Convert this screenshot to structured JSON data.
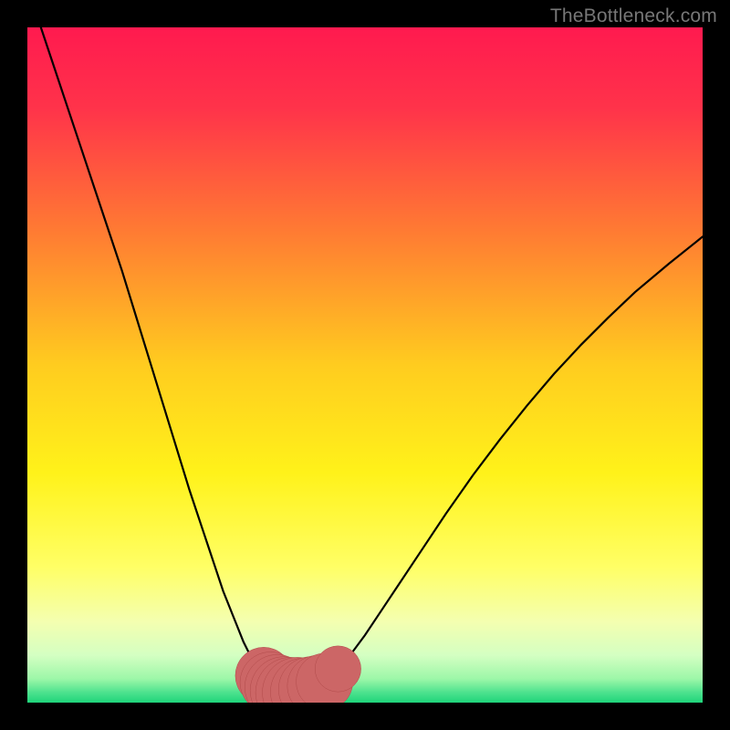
{
  "watermark": "TheBottleneck.com",
  "colors": {
    "frame": "#000000",
    "watermark": "#777777",
    "curve": "#000000",
    "markers_fill": "#cc6666",
    "markers_stroke": "#b24a4a",
    "gradient_stops": [
      {
        "offset": 0,
        "color": "#ff1a4f"
      },
      {
        "offset": 0.12,
        "color": "#ff334a"
      },
      {
        "offset": 0.3,
        "color": "#ff7a33"
      },
      {
        "offset": 0.5,
        "color": "#ffcc1f"
      },
      {
        "offset": 0.66,
        "color": "#fff21a"
      },
      {
        "offset": 0.8,
        "color": "#ffff66"
      },
      {
        "offset": 0.88,
        "color": "#f4ffb0"
      },
      {
        "offset": 0.93,
        "color": "#d4ffc2"
      },
      {
        "offset": 0.965,
        "color": "#9cf7a8"
      },
      {
        "offset": 0.985,
        "color": "#4de28e"
      },
      {
        "offset": 1.0,
        "color": "#1fd47a"
      }
    ]
  },
  "chart_data": {
    "type": "line",
    "title": "",
    "xlabel": "",
    "ylabel": "",
    "xlim": [
      0,
      100
    ],
    "ylim": [
      0,
      100
    ],
    "grid": false,
    "legend": false,
    "series": [
      {
        "name": "bottleneck-curve",
        "x": [
          2,
          4,
          6,
          8,
          10,
          12,
          14,
          16,
          18,
          20,
          22,
          24,
          25,
          26,
          27,
          28,
          29,
          30,
          31,
          32,
          33,
          34,
          35,
          36,
          37,
          38,
          39,
          40,
          41,
          42,
          44,
          46,
          48,
          50,
          52,
          55,
          58,
          62,
          66,
          70,
          74,
          78,
          82,
          86,
          90,
          95,
          100
        ],
        "y": [
          100,
          94,
          88,
          82,
          76,
          70,
          64,
          57.5,
          51,
          44.5,
          38,
          31.5,
          28.5,
          25.5,
          22.5,
          19.5,
          16.5,
          14,
          11.5,
          9,
          7,
          5.3,
          4,
          3,
          2.3,
          1.8,
          1.5,
          1.5,
          1.6,
          2,
          3.1,
          5,
          7.3,
          10,
          13,
          17.5,
          22,
          28,
          33.7,
          39,
          44,
          48.7,
          53,
          57,
          60.8,
          65,
          69
        ]
      }
    ],
    "markers": {
      "name": "highlight-points",
      "x": [
        35,
        36,
        37,
        38,
        39,
        40,
        41,
        42,
        43,
        44,
        46
      ],
      "y": [
        4.0,
        3.0,
        2.3,
        1.8,
        1.5,
        1.5,
        1.6,
        2.0,
        2.5,
        3.1,
        5.0
      ],
      "r": [
        4.2,
        4.5,
        4.8,
        5.0,
        5.2,
        5.2,
        5.0,
        4.8,
        4.5,
        4.2,
        3.4
      ]
    }
  }
}
